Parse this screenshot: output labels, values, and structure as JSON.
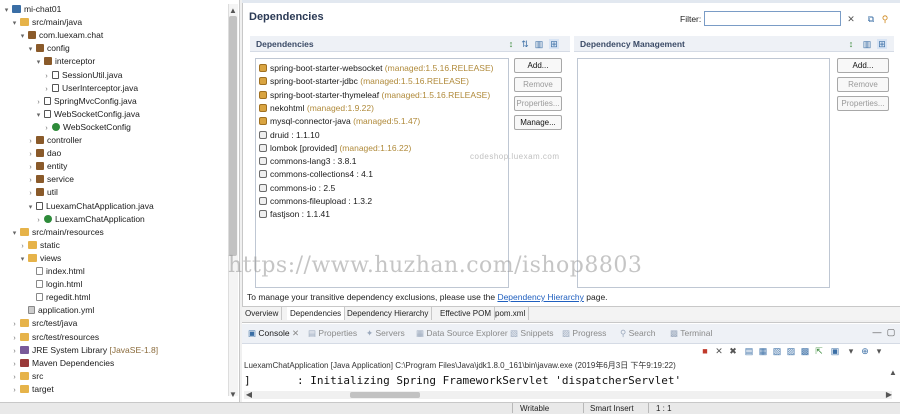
{
  "tree": {
    "items": [
      {
        "label": "mi-chat01",
        "icon": "project-icon",
        "twisty": "v",
        "indent": 0
      },
      {
        "label": "src/main/java",
        "icon": "source-folder-icon",
        "twisty": "v",
        "indent": 1
      },
      {
        "label": "com.luexam.chat",
        "icon": "package-icon",
        "twisty": "v",
        "indent": 2
      },
      {
        "label": "config",
        "icon": "package-icon",
        "twisty": "v",
        "indent": 3
      },
      {
        "label": "interceptor",
        "icon": "package-icon",
        "twisty": "v",
        "indent": 4
      },
      {
        "label": "SessionUtil.java",
        "icon": "java-file-icon",
        "twisty": ">",
        "indent": 5
      },
      {
        "label": "UserInterceptor.java",
        "icon": "java-file-icon",
        "twisty": ">",
        "indent": 5
      },
      {
        "label": "SpringMvcConfig.java",
        "icon": "java-file-icon",
        "twisty": ">",
        "indent": 4
      },
      {
        "label": "WebSocketConfig.java",
        "icon": "java-file-icon",
        "twisty": "v",
        "indent": 4
      },
      {
        "label": "WebSocketConfig",
        "icon": "class-icon",
        "twisty": ">",
        "indent": 5
      },
      {
        "label": "controller",
        "icon": "package-icon",
        "twisty": ">",
        "indent": 3
      },
      {
        "label": "dao",
        "icon": "package-icon",
        "twisty": ">",
        "indent": 3
      },
      {
        "label": "entity",
        "icon": "package-icon",
        "twisty": ">",
        "indent": 3
      },
      {
        "label": "service",
        "icon": "package-icon",
        "twisty": ">",
        "indent": 3
      },
      {
        "label": "util",
        "icon": "package-icon",
        "twisty": ">",
        "indent": 3
      },
      {
        "label": "LuexamChatApplication.java",
        "icon": "java-file-icon",
        "twisty": "v",
        "indent": 3
      },
      {
        "label": "LuexamChatApplication",
        "icon": "class-icon",
        "twisty": ">",
        "indent": 4
      },
      {
        "label": "src/main/resources",
        "icon": "source-folder-icon",
        "twisty": "v",
        "indent": 1
      },
      {
        "label": "static",
        "icon": "folder-icon",
        "twisty": ">",
        "indent": 2
      },
      {
        "label": "views",
        "icon": "folder-icon",
        "twisty": "v",
        "indent": 2
      },
      {
        "label": "index.html",
        "icon": "html-file-icon",
        "twisty": "",
        "indent": 3
      },
      {
        "label": "login.html",
        "icon": "html-file-icon",
        "twisty": "",
        "indent": 3
      },
      {
        "label": "regedit.html",
        "icon": "html-file-icon",
        "twisty": "",
        "indent": 3
      },
      {
        "label": "application.yml",
        "icon": "yml-file-icon",
        "twisty": "",
        "indent": 2
      },
      {
        "label": "src/test/java",
        "icon": "source-folder-icon",
        "twisty": ">",
        "indent": 1
      },
      {
        "label": "src/test/resources",
        "icon": "source-folder-icon",
        "twisty": ">",
        "indent": 1
      },
      {
        "label": "JRE System Library",
        "suffix": " [JavaSE-1.8]",
        "icon": "library-icon",
        "twisty": ">",
        "indent": 1
      },
      {
        "label": "Maven Dependencies",
        "icon": "maven-library-icon",
        "twisty": ">",
        "indent": 1
      },
      {
        "label": "src",
        "icon": "folder-icon",
        "twisty": ">",
        "indent": 1
      },
      {
        "label": "target",
        "icon": "folder-icon",
        "twisty": ">",
        "indent": 1
      }
    ]
  },
  "editor": {
    "title": "Dependencies",
    "filter_label": "Filter:",
    "filter_value": "",
    "dependencies_header": "Dependencies",
    "management_header": "Dependency Management",
    "dependencies": [
      {
        "name": "spring-boot-starter-websocket",
        "extra": " (managed:1.5.16.RELEASE)",
        "managed": true
      },
      {
        "name": "spring-boot-starter-jdbc",
        "extra": " (managed:1.5.16.RELEASE)",
        "managed": true
      },
      {
        "name": "spring-boot-starter-thymeleaf",
        "extra": " (managed:1.5.16.RELEASE)",
        "managed": true
      },
      {
        "name": "nekohtml",
        "extra": " (managed:1.9.22)",
        "managed": true
      },
      {
        "name": "mysql-connector-java",
        "extra": " (managed:5.1.47)",
        "managed": true
      },
      {
        "name": "druid : 1.1.10",
        "extra": "",
        "managed": false
      },
      {
        "name": "lombok [provided]",
        "extra": " (managed:1.16.22)",
        "managed": false
      },
      {
        "name": "commons-lang3 : 3.8.1",
        "extra": "",
        "managed": false
      },
      {
        "name": "commons-collections4 : 4.1",
        "extra": "",
        "managed": false
      },
      {
        "name": "commons-io : 2.5",
        "extra": "",
        "managed": false
      },
      {
        "name": "commons-fileupload : 1.3.2",
        "extra": "",
        "managed": false
      },
      {
        "name": "fastjson : 1.1.41",
        "extra": "",
        "managed": false
      }
    ],
    "dep_buttons": {
      "add": "Add...",
      "remove": "Remove",
      "properties": "Properties...",
      "manage": "Manage..."
    },
    "mgmt_buttons": {
      "add": "Add...",
      "remove": "Remove",
      "properties": "Properties..."
    },
    "small_watermark": "codeshop.luexam.com",
    "note_prefix": "To manage your transitive dependency exclusions, please use the ",
    "note_link": "Dependency Hierarchy",
    "note_suffix": " page.",
    "pom_tabs": [
      "Overview",
      "Dependencies",
      "Dependency Hierarchy",
      "Effective POM",
      "pom.xml"
    ]
  },
  "console": {
    "tabs": [
      {
        "label": "Console",
        "active": true
      },
      {
        "label": "Properties",
        "active": false
      },
      {
        "label": "Servers",
        "active": false
      },
      {
        "label": "Data Source Explorer",
        "active": false
      },
      {
        "label": "Snippets",
        "active": false
      },
      {
        "label": "Progress",
        "active": false
      },
      {
        "label": "Search",
        "active": false
      },
      {
        "label": "Terminal",
        "active": false
      }
    ],
    "launch": "LuexamChatApplication [Java Application] C:\\Program Files\\Java\\jdk1.8.0_161\\bin\\javaw.exe (2019年6月3日 下午9:19:22)",
    "log": "]       : Initializing Spring FrameworkServlet 'dispatcherServlet'"
  },
  "watermark": "https://www.huzhan.com/ishop8803",
  "status": {
    "writable": "Writable",
    "insert": "Smart Insert",
    "position": "1 : 1"
  }
}
